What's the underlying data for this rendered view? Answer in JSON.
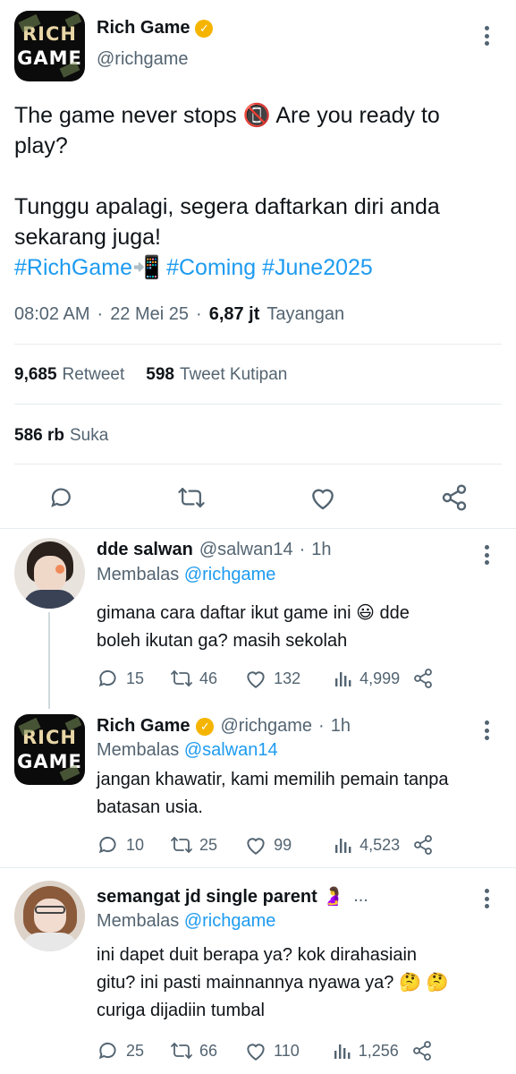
{
  "tweet": {
    "author_name": "Rich Game",
    "author_handle": "@richgame",
    "logo_line1": "RICH",
    "logo_line2": "GAME",
    "text_line1": "The game never stops 📵 Are you ready to",
    "text_line2": "play?",
    "text_line3": "Tunggu apalagi, segera daftarkan diri anda",
    "text_line4": "sekarang juga!",
    "hashtag1": "#RichGame📲",
    "hashtag2": "#Coming",
    "hashtag3": "#June2025",
    "time": "08:02 AM",
    "date": "22 Mei 25",
    "views_count": "6,87 jt",
    "views_label": "Tayangan",
    "retweets_count": "9,685",
    "retweets_label": "Retweet",
    "quotes_count": "598",
    "quotes_label": "Tweet Kutipan",
    "likes_count": "586 rb",
    "likes_label": "Suka"
  },
  "replies": [
    {
      "name": "dde salwan",
      "handle": "@salwan14",
      "age": "1h",
      "replying_prefix": "Membalas",
      "replying_to": "@richgame",
      "line1": "gimana cara daftar ikut game ini 😃 dde",
      "line2": "boleh ikutan ga? masih sekolah",
      "replies": "15",
      "retweets": "46",
      "likes": "132",
      "views": "4,999"
    },
    {
      "name": "Rich Game",
      "handle": "@richgame",
      "age": "1h",
      "replying_prefix": "Membalas",
      "replying_to": "@salwan14",
      "line1": "jangan khawatir, kami memilih pemain tanpa",
      "line2": "batasan usia.",
      "replies": "10",
      "retweets": "25",
      "likes": "99",
      "views": "4,523"
    },
    {
      "name": "semangat jd single parent 🤰",
      "handle": "...",
      "replying_prefix": "Membalas",
      "replying_to": "@richgame",
      "line1": "ini dapet duit berapa ya? kok dirahasiain",
      "line2": "gitu? ini pasti mainnannya nyawa ya? 🤔 🤔",
      "line3": "curiga dijadiin tumbal",
      "replies": "25",
      "retweets": "66",
      "likes": "110",
      "views": "1,256"
    }
  ],
  "colors": {
    "link": "#1d9bf0",
    "muted": "#536471",
    "verified": "#f5b400",
    "divider": "#e6ecf0"
  },
  "icons": [
    "kebab-icon",
    "verified-icon",
    "reply-icon",
    "retweet-icon",
    "like-icon",
    "share-icon",
    "views-icon"
  ]
}
